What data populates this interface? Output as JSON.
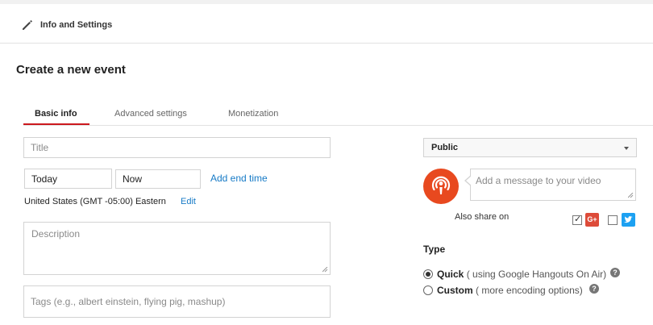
{
  "header": {
    "title": "Info and Settings",
    "icon": "pencil-icon"
  },
  "page": {
    "title": "Create a new event"
  },
  "tabs": [
    {
      "label": "Basic info",
      "active": true
    },
    {
      "label": "Advanced settings",
      "active": false
    },
    {
      "label": "Monetization",
      "active": false
    }
  ],
  "form": {
    "title_placeholder": "Title",
    "start_date": "Today",
    "start_time": "Now",
    "add_end_time": "Add end time",
    "timezone": "United States (GMT -05:00) Eastern",
    "timezone_edit": "Edit",
    "description_placeholder": "Description",
    "tags_placeholder": "Tags (e.g., albert einstein, flying pig, mashup)"
  },
  "sharing": {
    "privacy": "Public",
    "message_placeholder": "Add a message to your video",
    "also_share_on": "Also share on",
    "google_plus_checked": true,
    "twitter_checked": false,
    "google_plus_label": "G+"
  },
  "type": {
    "label": "Type",
    "options": [
      {
        "name": "Quick",
        "detail": "( using Google Hangouts On Air)",
        "selected": true
      },
      {
        "name": "Custom",
        "detail": "( more encoding options)",
        "selected": false
      }
    ]
  },
  "colors": {
    "accent_red": "#cc181e",
    "link_blue": "#167ac6",
    "avatar_orange": "#e8491f",
    "google_plus_red": "#dd4b39",
    "twitter_blue": "#1da1f2"
  }
}
